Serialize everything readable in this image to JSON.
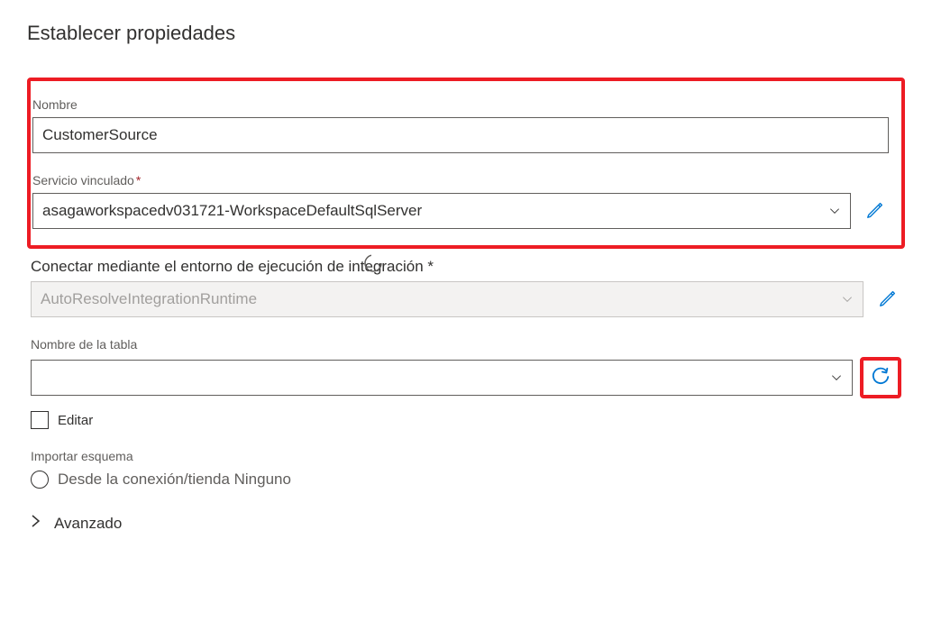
{
  "page": {
    "title": "Establecer propiedades"
  },
  "fields": {
    "name": {
      "label": "Nombre",
      "value": "CustomerSource"
    },
    "linked_service": {
      "label": "Servicio vinculado",
      "value": "asagaworkspacedv031721-WorkspaceDefaultSqlServer"
    },
    "integration_runtime": {
      "label": "Conectar mediante el entorno de ejecución de integración *",
      "value": "AutoResolveIntegrationRuntime"
    },
    "table_name": {
      "label": "Nombre de la tabla",
      "value": "",
      "edit_label": "Editar"
    },
    "import_schema": {
      "label": "Importar esquema",
      "option_label": "Desde la conexión/tienda Ninguno"
    },
    "advanced": {
      "label": "Avanzado"
    }
  }
}
